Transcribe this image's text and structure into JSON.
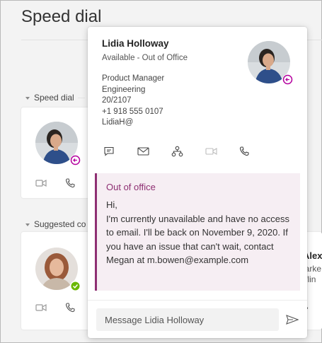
{
  "page": {
    "title": "Speed dial"
  },
  "sections": {
    "speed_dial": "Speed dial",
    "suggested": "Suggested co"
  },
  "peek_card": {
    "name_fragment": "Alex",
    "line1": "larke",
    "line2": "fflin",
    "dots": "•"
  },
  "contact": {
    "name": "Lidia Holloway",
    "status": "Available - Out of Office",
    "title": "Product Manager",
    "department": "Engineering",
    "office": "20/2107",
    "phone": "+1 918 555 0107",
    "email": "LidiaH@"
  },
  "out_of_office": {
    "title": "Out of office",
    "greeting": "Hi,",
    "body": "I'm currently unavailable and have no access to email. I'll be back on November 9, 2020. If you have an issue that can't wait, contact Megan at m.bowen@example.com"
  },
  "message": {
    "placeholder": "Message Lidia Holloway"
  },
  "icons": {
    "chat": "chat-icon",
    "mail": "mail-icon",
    "org": "org-chart-icon",
    "video": "video-icon",
    "call": "phone-icon",
    "send": "send-icon"
  },
  "colors": {
    "accent_ooo": "#8e2f72",
    "ooo_bg": "#f6eef3",
    "available_green": "#6bb700"
  }
}
